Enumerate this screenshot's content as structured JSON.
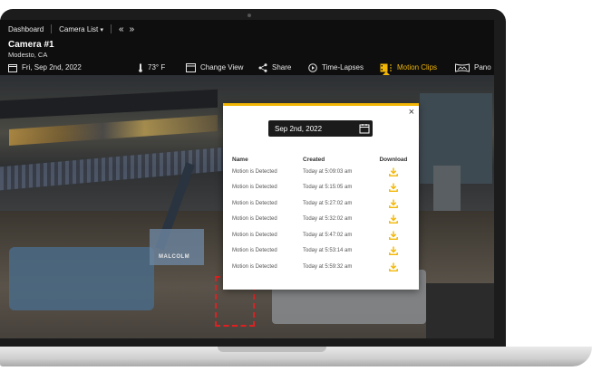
{
  "nav": {
    "dashboard": "Dashboard",
    "camera_list": "Camera List",
    "camera_list_caret": "▾",
    "prev": "«",
    "next": "»"
  },
  "camera": {
    "title": "Camera #1",
    "location": "Modesto, CA"
  },
  "toolbar": {
    "date": "Fri, Sep 2nd, 2022",
    "temperature": "73° F",
    "change_view": "Change View",
    "share": "Share",
    "time_lapses": "Time-Lapses",
    "motion_clips": "Motion Clips",
    "pano": "Pano"
  },
  "scene": {
    "machine_label": "MALCOLM"
  },
  "modal": {
    "close": "×",
    "date_value": "Sep 2nd, 2022",
    "headers": {
      "name": "Name",
      "created": "Created",
      "download": "Download"
    },
    "clips": [
      {
        "name": "Motion is Detected",
        "created": "Today at 5:09:03 am"
      },
      {
        "name": "Motion is Detected",
        "created": "Today at 5:15:05 am"
      },
      {
        "name": "Motion is Detected",
        "created": "Today at 5:27:02 am"
      },
      {
        "name": "Motion is Detected",
        "created": "Today at 5:32:02 am"
      },
      {
        "name": "Motion is Detected",
        "created": "Today at 5:47:02 am"
      },
      {
        "name": "Motion is Detected",
        "created": "Today at 5:53:14 am"
      },
      {
        "name": "Motion is Detected",
        "created": "Today at 5:59:32 am"
      }
    ]
  },
  "colors": {
    "accent": "#f2b705",
    "detection": "#e02020",
    "chrome": "#0e0e0e"
  },
  "icons": {
    "calendar": "calendar-icon",
    "thermometer": "thermometer-icon",
    "change_view": "change-view-icon",
    "share": "share-icon",
    "time_lapses": "play-circle-icon",
    "motion_clips": "film-icon",
    "pano": "panorama-icon",
    "download": "download-icon"
  }
}
